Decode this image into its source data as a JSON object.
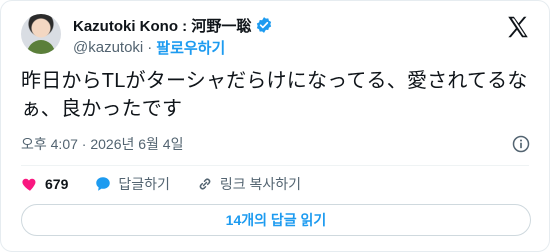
{
  "author": {
    "name": "Kazutoki Kono : 河野一聡",
    "handle": "@kazutoki",
    "separator": "·",
    "follow_label": "팔로우하기"
  },
  "tweet": {
    "text": "昨日からTLがターシャだらけになってる、愛されてるなぁ、良かったです",
    "timestamp": "오후 4:07 · 2026년 6월 4일"
  },
  "actions": {
    "likes_count": "679",
    "reply_label": "답글하기",
    "copy_link_label": "링크 복사하기"
  },
  "replies_button_label": "14개의 답글 읽기",
  "colors": {
    "accent": "#1d9bf0",
    "like": "#f91880",
    "muted": "#536471"
  }
}
